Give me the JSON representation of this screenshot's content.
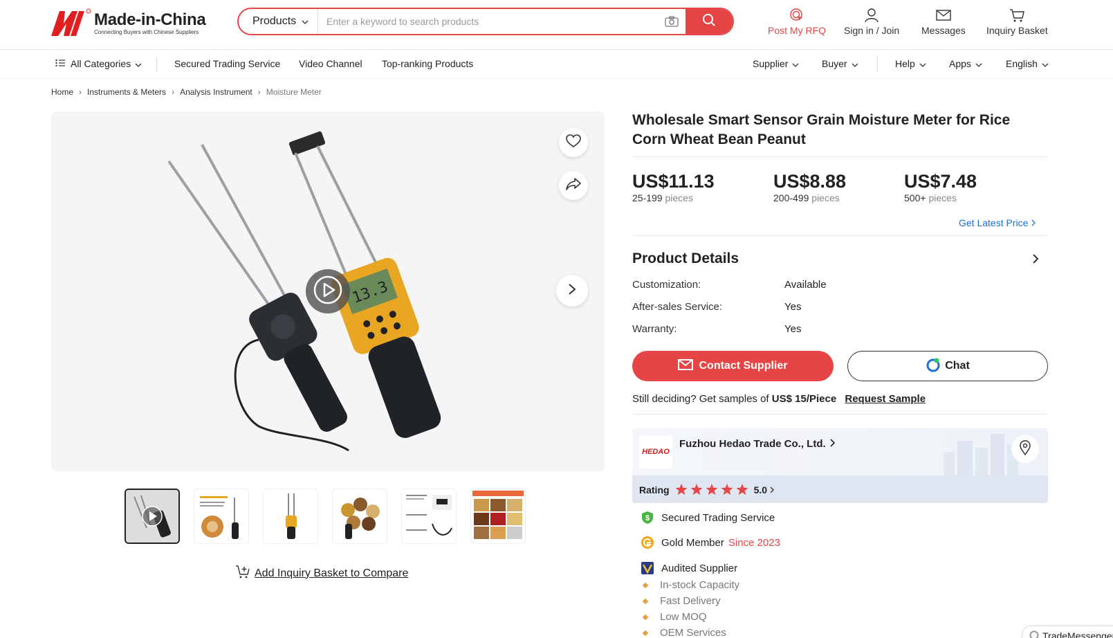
{
  "header": {
    "logo_name": "Made-in-China",
    "logo_tagline": "Connecting Buyers with Chinese Suppliers",
    "search": {
      "category": "Products",
      "placeholder": "Enter a keyword to search products"
    },
    "links": {
      "post_rfq": "Post My RFQ",
      "sign_in": "Sign in / Join",
      "messages": "Messages",
      "inquiry_basket": "Inquiry Basket"
    },
    "accent_color": "#e64545"
  },
  "navbar": {
    "all_categories": "All Categories",
    "left_items": [
      "Secured Trading Service",
      "Video Channel",
      "Top-ranking Products"
    ],
    "right_items": [
      "Supplier",
      "Buyer",
      "Help",
      "Apps",
      "English"
    ]
  },
  "breadcrumb": [
    "Home",
    "Instruments & Meters",
    "Analysis Instrument",
    "Moisture Meter"
  ],
  "gallery": {
    "compare_label": "Add Inquiry Basket to Compare",
    "thumbnail_count": 6
  },
  "product": {
    "title": "Wholesale Smart Sensor Grain Moisture Meter for Rice Corn Wheat Bean Peanut",
    "prices": [
      {
        "amount": "US$11.13",
        "range": "25-199",
        "unit": "pieces"
      },
      {
        "amount": "US$8.88",
        "range": "200-499",
        "unit": "pieces"
      },
      {
        "amount": "US$7.48",
        "range": "500+",
        "unit": "pieces"
      }
    ],
    "get_latest_price": "Get Latest Price",
    "details_title": "Product Details",
    "details": [
      {
        "label": "Customization:",
        "value": "Available"
      },
      {
        "label": "After-sales Service:",
        "value": "Yes"
      },
      {
        "label": "Warranty:",
        "value": "Yes"
      }
    ],
    "contact_label": "Contact Supplier",
    "chat_label": "Chat",
    "sample_prefix": "Still deciding? Get samples of",
    "sample_price": "US$ 15/Piece",
    "sample_link": "Request Sample"
  },
  "supplier": {
    "logo_text": "HEDAO",
    "name": "Fuzhou Hedao Trade Co., Ltd.",
    "rating_label": "Rating",
    "rating_value": "5.0",
    "stars": 5,
    "badges": {
      "secured": "Secured Trading Service",
      "gold": "Gold Member",
      "gold_since": "Since 2023",
      "audited": "Audited Supplier"
    },
    "features": [
      "In-stock Capacity",
      "Fast Delivery",
      "Low MOQ",
      "OEM Services"
    ]
  },
  "trade_messenger": "TradeMessenger"
}
